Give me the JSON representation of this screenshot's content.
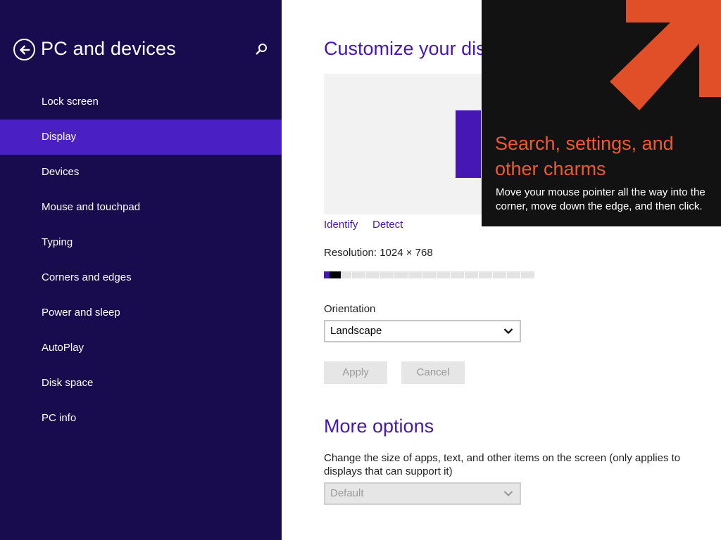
{
  "nav": {
    "title": "PC and devices",
    "items": [
      {
        "label": "Lock screen",
        "selected": false
      },
      {
        "label": "Display",
        "selected": true
      },
      {
        "label": "Devices",
        "selected": false
      },
      {
        "label": "Mouse and touchpad",
        "selected": false
      },
      {
        "label": "Typing",
        "selected": false
      },
      {
        "label": "Corners and edges",
        "selected": false
      },
      {
        "label": "Power and sleep",
        "selected": false
      },
      {
        "label": "AutoPlay",
        "selected": false
      },
      {
        "label": "Disk space",
        "selected": false
      },
      {
        "label": "PC info",
        "selected": false
      }
    ]
  },
  "main": {
    "heading": "Customize your disp",
    "identify_label": "Identify",
    "detect_label": "Detect",
    "resolution_label": "Resolution: 1024 × 768",
    "resolution_slider": {
      "segments": 15,
      "position_fraction": 0.05
    },
    "orientation_label": "Orientation",
    "orientation_value": "Landscape",
    "apply_label": "Apply",
    "cancel_label": "Cancel",
    "more_options_heading": "More options",
    "size_description": "Change the size of apps, text, and other items on the screen (only applies to displays that can support it)",
    "size_value": "Default"
  },
  "tip": {
    "title": "Search, settings, and other charms",
    "body": "Move your mouse pointer all the way into the corner, move down the edge, and then click."
  },
  "colors": {
    "nav_background": "#180c4f",
    "nav_selected": "#4a1fc4",
    "accent": "#4617b4",
    "tip_background": "#121212",
    "tip_accent": "#e85b33"
  },
  "icons": {
    "back": "back-arrow-icon",
    "search": "search-icon",
    "dropdown": "chevron-down-icon",
    "pointer": "diagonal-arrow-icon"
  }
}
